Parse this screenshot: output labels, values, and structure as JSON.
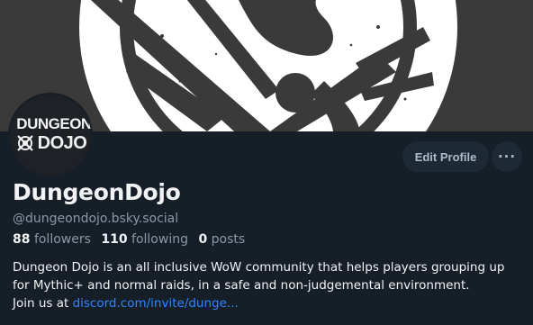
{
  "profile": {
    "display_name": "DungeonDojo",
    "handle": "@dungeondojo.bsky.social",
    "followers_count": "88",
    "followers_label": "followers",
    "following_count": "110",
    "following_label": "following",
    "posts_count": "0",
    "posts_label": "posts",
    "bio_line1": "Dungeon Dojo is an all inclusive WoW community that helps players grouping up",
    "bio_line2": "for Mythic+ and normal raids, in a safe and non-judgemental environment.",
    "bio_line3_prefix": "Join us at ",
    "bio_link": "discord.com/invite/dunge..."
  },
  "avatar": {
    "logo_top": "DUNGEON",
    "logo_bottom": "DOJO",
    "icon": "dungeon-dojo-logo"
  },
  "actions": {
    "edit_label": "Edit Profile",
    "more_label": "···"
  },
  "colors": {
    "background": "#161e27",
    "banner": "#3a3a3a",
    "accent_link": "#2f86ff",
    "secondary_text": "#8b98a5",
    "button_bg": "#1e2936"
  }
}
